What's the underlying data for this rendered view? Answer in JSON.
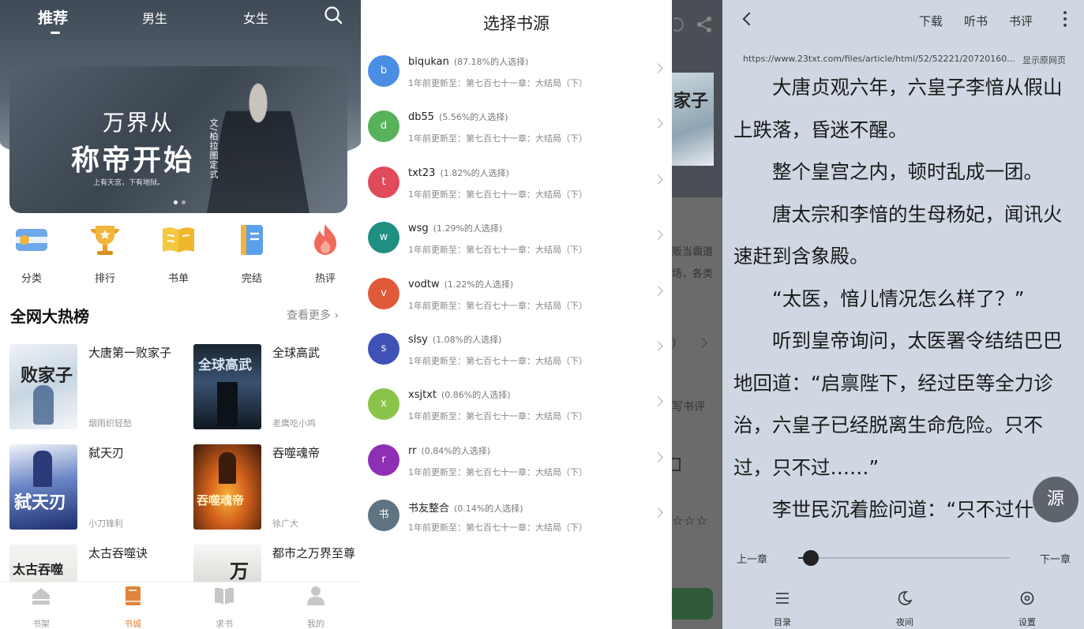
{
  "store": {
    "tabs": [
      {
        "label": "推荐",
        "active": true
      },
      {
        "label": "男生",
        "active": false
      },
      {
        "label": "女生",
        "active": false
      }
    ],
    "banner": {
      "title_line1": "万界从",
      "title_line2": "称帝开始",
      "author": "文/柏拉图定式",
      "tagline": "上有天宫，下有地狱。"
    },
    "categories": [
      {
        "label": "分类",
        "icon": "category-icon"
      },
      {
        "label": "排行",
        "icon": "trophy-icon"
      },
      {
        "label": "书单",
        "icon": "book-list-icon"
      },
      {
        "label": "完结",
        "icon": "finished-book-icon"
      },
      {
        "label": "热评",
        "icon": "flame-icon"
      }
    ],
    "hot_title": "全网大热榜",
    "hot_more": "查看更多 ›",
    "books": [
      {
        "name": "大唐第一败家子",
        "author": "烟雨织轻愁",
        "cover_text": "败家子"
      },
      {
        "name": "全球高武",
        "author": "老鹰吃小鸡",
        "cover_text": "全球高武"
      },
      {
        "name": "弑天刃",
        "author": "小刀锋利",
        "cover_text": "弑天刃"
      },
      {
        "name": "吞噬魂帝",
        "author": "徐广大",
        "cover_text": "吞噬魂帝"
      },
      {
        "name": "太古吞噬诀",
        "author": "",
        "cover_text": "太古吞噬"
      },
      {
        "name": "都市之万界至尊",
        "author": "",
        "cover_text": "万"
      }
    ],
    "tabbar": [
      {
        "label": "书架",
        "icon": "bookshelf-icon",
        "active": false
      },
      {
        "label": "书城",
        "icon": "bookstore-icon",
        "active": true
      },
      {
        "label": "求书",
        "icon": "request-book-icon",
        "active": false
      },
      {
        "label": "我的",
        "icon": "profile-icon",
        "active": false
      }
    ]
  },
  "sources": {
    "title": "选择书源",
    "items": [
      {
        "letter": "b",
        "name": "biqukan",
        "percent": "(87.18%的人选择)",
        "update": "1年前更新至：第七百七十一章：大结局（下）",
        "color": "#4a8fe3"
      },
      {
        "letter": "d",
        "name": "db55",
        "percent": "(5.56%的人选择)",
        "update": "1年前更新至：第七百七十一章：大结局（下）",
        "color": "#58b25a"
      },
      {
        "letter": "t",
        "name": "txt23",
        "percent": "(1.82%的人选择)",
        "update": "1年前更新至：第七百七十一章：大结局（下）",
        "color": "#e04a5a"
      },
      {
        "letter": "w",
        "name": "wsg",
        "percent": "(1.29%的人选择)",
        "update": "1年前更新至：第七百七十一章：大结局（下）",
        "color": "#1f8f82"
      },
      {
        "letter": "v",
        "name": "vodtw",
        "percent": "(1.22%的人选择)",
        "update": "1年前更新至：第七百七十一章：大结局（下）",
        "color": "#e05a3a"
      },
      {
        "letter": "s",
        "name": "slsy",
        "percent": "(1.08%的人选择)",
        "update": "1年前更新至：第七百七十一章：大结局（下）",
        "color": "#3f51b5"
      },
      {
        "letter": "x",
        "name": "xsjtxt",
        "percent": "(0.86%的人选择)",
        "update": "1年前更新至：第七百七十一章：大结局（下）",
        "color": "#8bc34a"
      },
      {
        "letter": "r",
        "name": "rr",
        "percent": "(0.84%的人选择)",
        "update": "1年前更新至：第七百七十一章：大结局（下）",
        "color": "#8e2fb5"
      },
      {
        "letter": "书",
        "name": "书友整合",
        "percent": "(0.14%的人选择)",
        "update": "1年前更新至：第七百七十一章：大结局（下）",
        "color": "#5f7380"
      }
    ]
  },
  "strip": {
    "cover_text": "家子",
    "text1": "贩当霸道场，各类",
    "text2": "写书评",
    "stars": "☆☆☆",
    "num": ")"
  },
  "reader": {
    "actions": [
      "下载",
      "听书",
      "书评"
    ],
    "url": "https://www.23txt.com/files/article/html/52/52221/20720160...",
    "show_original": "显示原网页",
    "paragraphs": [
      "大唐贞观六年，六皇子李愔从假山上跌落，昏迷不醒。",
      "整个皇宫之内，顿时乱成一团。",
      "唐太宗和李愔的生母杨妃，闻讯火速赶到含象殿。",
      "“太医，愔儿情况怎么样了？”",
      "听到皇帝询问，太医署令结结巴巴地回道：“启禀陛下，经过臣等全力诊治，六皇子已经脱离生命危险。只不过，只不过……”",
      "李世民沉着脸问道：“只不过什"
    ],
    "source_button": "源",
    "prev_chapter": "上一章",
    "next_chapter": "下一章",
    "progress": 0.06,
    "bottom": [
      {
        "label": "目录",
        "icon": "menu-icon"
      },
      {
        "label": "夜间",
        "icon": "moon-icon"
      },
      {
        "label": "设置",
        "icon": "settings-icon"
      }
    ]
  }
}
